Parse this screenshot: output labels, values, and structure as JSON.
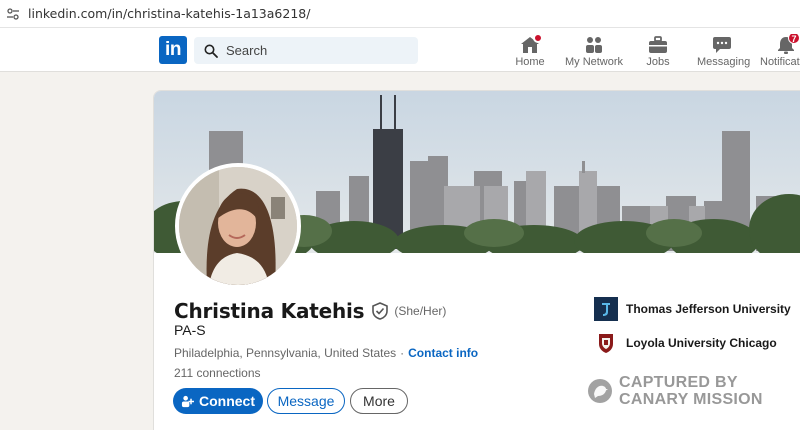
{
  "browser": {
    "url": "linkedin.com/in/christina-katehis-1a13a6218/"
  },
  "nav": {
    "logo_text": "in",
    "search_placeholder": "Search",
    "items": [
      {
        "label": "Home",
        "icon": "home-icon",
        "badge": ""
      },
      {
        "label": "My Network",
        "icon": "people-icon",
        "badge": ""
      },
      {
        "label": "Jobs",
        "icon": "briefcase-icon",
        "badge": ""
      },
      {
        "label": "Messaging",
        "icon": "chat-icon",
        "badge": ""
      },
      {
        "label": "Notifications",
        "icon": "bell-icon",
        "badge": "7"
      }
    ]
  },
  "profile": {
    "name": "Christina Katehis",
    "pronouns": "(She/Her)",
    "headline": "PA-S",
    "location": "Philadelphia, Pennsylvania, United States",
    "separator": "·",
    "contact_info_label": "Contact info",
    "connections": "211 connections",
    "buttons": {
      "connect": "Connect",
      "message": "Message",
      "more": "More"
    },
    "education": [
      {
        "name": "Thomas Jefferson University",
        "logo": "jefferson-logo"
      },
      {
        "name": "Loyola University Chicago",
        "logo": "loyola-logo"
      }
    ]
  },
  "watermark": {
    "line1": "CAPTURED BY",
    "line2": "CANARY MISSION"
  },
  "colors": {
    "brand": "#0a66c2",
    "badge": "#cb112d",
    "page_bg": "#f4f2ee"
  }
}
